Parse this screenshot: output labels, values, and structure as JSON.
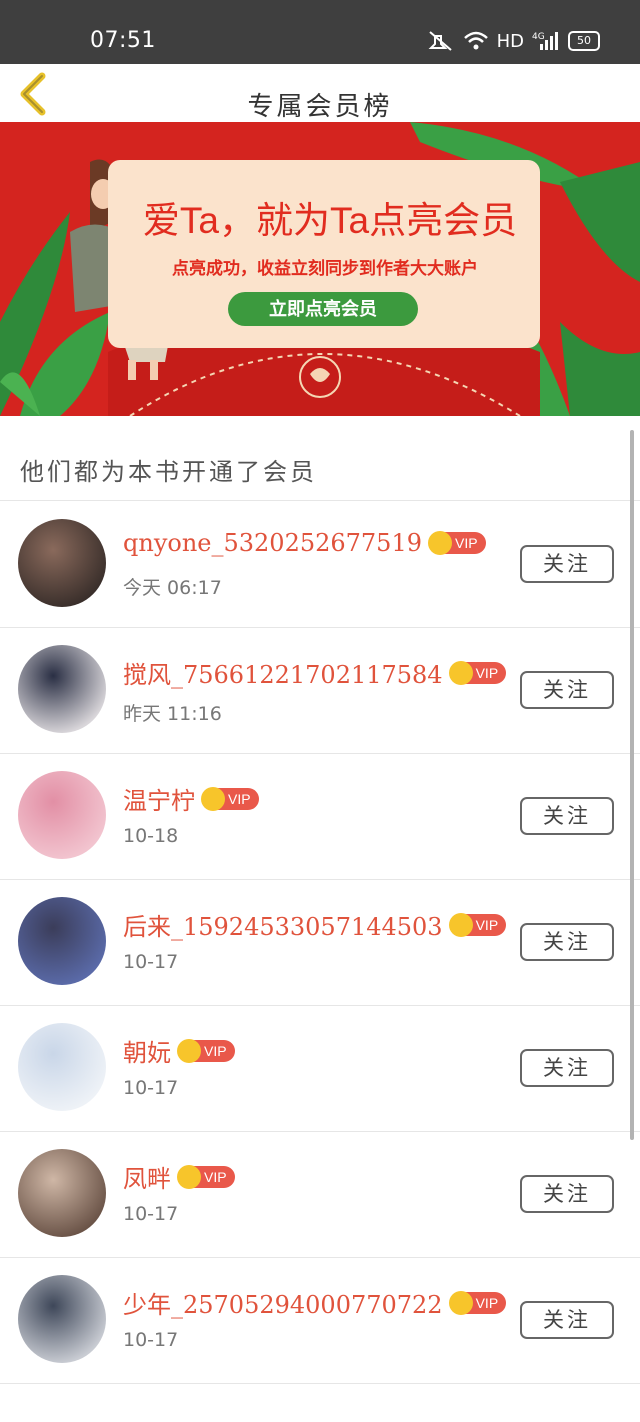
{
  "status_bar": {
    "time": "07:51",
    "network": "HD",
    "signal_label": "4G",
    "battery": "50"
  },
  "header": {
    "title": "专属会员榜"
  },
  "banner": {
    "headline": "爱Ta，就为Ta点亮会员",
    "subtitle": "点亮成功，收益立刻同步到作者大大账户",
    "cta": "立即点亮会员",
    "colors": {
      "background": "#d4241f",
      "card": "#fbe3cc",
      "cta": "#3c9a3e"
    }
  },
  "section_title": "他们都为本书开通了会员",
  "vip_label": "VIP",
  "members": [
    {
      "name": "qnyone_5320252677519",
      "time": "今天 06:17",
      "follow": "关注"
    },
    {
      "name": "搅风_75661221702117584",
      "time": "昨天 11:16",
      "follow": "关注"
    },
    {
      "name": "温宁柠",
      "time": "10-18",
      "follow": "关注"
    },
    {
      "name": "后来_15924533057144503",
      "time": "10-17",
      "follow": "关注"
    },
    {
      "name": "朝妧",
      "time": "10-17",
      "follow": "关注"
    },
    {
      "name": "凤畔",
      "time": "10-17",
      "follow": "关注"
    },
    {
      "name": "少年_25705294000770722",
      "time": "10-17",
      "follow": "关注"
    }
  ],
  "colors": {
    "accent_name": "#e0533c",
    "vip_badge": "#e9584a",
    "crown": "#f7c52b"
  }
}
